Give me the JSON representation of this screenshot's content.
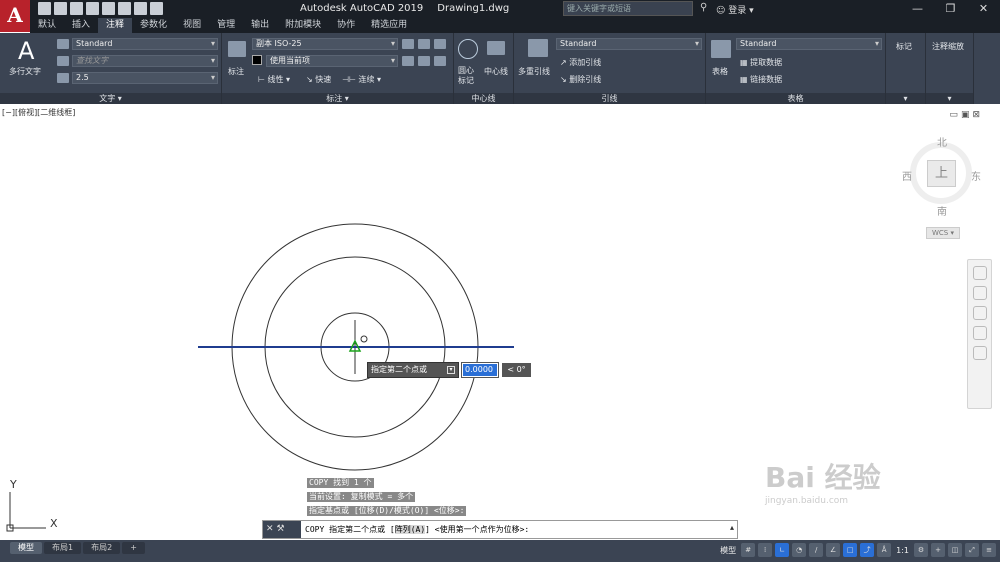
{
  "app": {
    "logo": "A",
    "title": "Autodesk AutoCAD 2019",
    "file": "Drawing1.dwg",
    "search_placeholder": "键入关键字或短语",
    "login": "登录"
  },
  "tabs": [
    "默认",
    "插入",
    "注释",
    "参数化",
    "视图",
    "管理",
    "输出",
    "附加模块",
    "协作",
    "精选应用"
  ],
  "active_tab": "注释",
  "ribbon": {
    "text": {
      "big_button": "多行文字",
      "style": "Standard",
      "find_placeholder": "查找文字",
      "height": "2.5",
      "label": "文字 ▾"
    },
    "dim": {
      "big_button": "标注",
      "style": "副本 ISO-25",
      "layer": "使用当前项",
      "linear": "线性",
      "quick": "快速",
      "continue": "连续",
      "label": "标注 ▾"
    },
    "centerline": {
      "center_mark": "圆心\n标记",
      "center_line": "中心线",
      "label": "中心线"
    },
    "leader": {
      "big_button": "多重引线",
      "style": "Standard",
      "add": "添加引线",
      "remove": "删除引线",
      "label": "引线"
    },
    "table": {
      "big_button": "表格",
      "style": "Standard",
      "extract": "提取数据",
      "link": "链接数据",
      "label": "表格"
    },
    "markup": {
      "label": "标记"
    },
    "scale": {
      "label": "注释缩放"
    }
  },
  "viewport": {
    "label": "[−][俯视][二维线框]",
    "viewcube": {
      "top": "上",
      "north": "北",
      "south": "南",
      "east": "东",
      "west": "西",
      "wcs": "WCS ▾"
    }
  },
  "dynamic_input": {
    "prompt": "指定第二个点或",
    "value": "0.0000",
    "angle": "< 0°"
  },
  "history": [
    "COPY 找到 1 个",
    "当前设置:  复制模式 = 多个",
    "指定基点或 [位移(D)/模式(O)] <位移>:"
  ],
  "command": {
    "prefix": "COPY 指定第二个点或 [",
    "option": "阵列(A)",
    "suffix": "] <使用第一个点作为位移>:"
  },
  "layouts": [
    "模型",
    "布局1",
    "布局2",
    "+"
  ],
  "status": {
    "model": "模型",
    "scale": "1:1"
  },
  "watermark": {
    "text": "Bai 经验",
    "url": "jingyan.baidu.com"
  },
  "colors": {
    "accent": "#2a6fd6",
    "logo": "#b8222b",
    "ribbon": "#3b4453"
  }
}
